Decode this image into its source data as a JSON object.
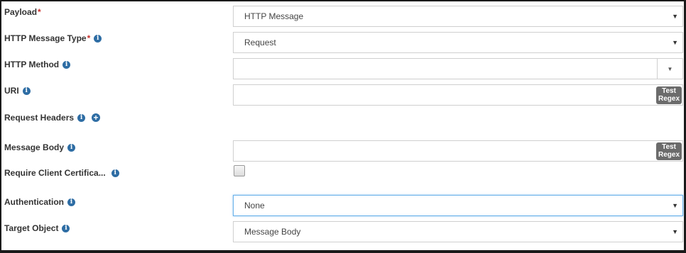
{
  "payload": {
    "label": "Payload",
    "required": "*",
    "value": "HTTP Message"
  },
  "http_message_type": {
    "label": "HTTP Message Type",
    "required": "*",
    "value": "Request"
  },
  "http_method": {
    "label": "HTTP Method",
    "value": ""
  },
  "uri": {
    "label": "URI",
    "value": "",
    "test_regex_line1": "Test",
    "test_regex_line2": "Regex"
  },
  "request_headers": {
    "label": "Request Headers",
    "add_icon": "plus-circle-icon"
  },
  "message_body": {
    "label": "Message Body",
    "value": "",
    "test_regex_line1": "Test",
    "test_regex_line2": "Regex"
  },
  "require_client_certificate": {
    "label": "Require Client Certifica...",
    "checked": false
  },
  "authentication": {
    "label": "Authentication",
    "value": "None"
  },
  "target_object": {
    "label": "Target Object",
    "value": "Message Body"
  },
  "icons": {
    "info": "info-circle-icon",
    "caret": "caret-down-icon"
  },
  "colors": {
    "info_icon": "#2e6da4",
    "required": "#c9302c",
    "test_button": "#6b6b6b",
    "focus_border": "#66afe9"
  }
}
